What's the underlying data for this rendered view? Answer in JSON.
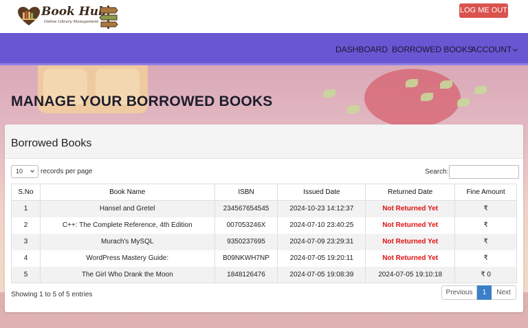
{
  "brand": {
    "name": "Book Hub",
    "tagline": "Online Library Management"
  },
  "header": {
    "logout_label": "LOG ME OUT"
  },
  "nav": {
    "items": [
      {
        "label": "DASHBOARD"
      },
      {
        "label": "BORROWED BOOKS"
      },
      {
        "label": "ACCOUNT"
      }
    ]
  },
  "page": {
    "title": "MANAGE YOUR BORROWED BOOKS"
  },
  "card": {
    "title": "Borrowed Books",
    "length_value": "10",
    "length_suffix": "records per page",
    "search_label": "Search:",
    "search_value": ""
  },
  "table": {
    "columns": [
      "S.No",
      "Book Name",
      "ISBN",
      "Issued Date",
      "Returned Date",
      "Fine Amount"
    ],
    "rows": [
      {
        "sno": "1",
        "name": "Hansel and Gretel",
        "isbn": "234567654545",
        "issued": "2024-10-23 14:12:37",
        "returned": "Not Returned Yet",
        "fine": "₹"
      },
      {
        "sno": "2",
        "name": "C++: The Complete Reference, 4th Edition",
        "isbn": "007053246X",
        "issued": "2024-07-10 23:40:25",
        "returned": "Not Returned Yet",
        "fine": "₹"
      },
      {
        "sno": "3",
        "name": "Murach's MySQL",
        "isbn": "9350237695",
        "issued": "2024-07-09 23:29:31",
        "returned": "Not Returned Yet",
        "fine": "₹"
      },
      {
        "sno": "4",
        "name": "WordPress Mastery Guide:",
        "isbn": "B09NKWH7NP",
        "issued": "2024-07-05 19:20:11",
        "returned": "Not Returned Yet",
        "fine": "₹"
      },
      {
        "sno": "5",
        "name": "The Girl Who Drank the Moon",
        "isbn": "1848126476",
        "issued": "2024-07-05 19:08:39",
        "returned": "2024-07-05 19:10:18",
        "fine": "₹ 0"
      }
    ]
  },
  "footer": {
    "info": "Showing 1 to 5 of 5 entries",
    "previous": "Previous",
    "current_page": "1",
    "next": "Next"
  },
  "colors": {
    "nav": "#6956d2",
    "logout": "#d9534f",
    "not_returned": "#e01010",
    "page_active": "#3a7fc7"
  },
  "icons": [
    "heart-books-logo",
    "signpost-icon",
    "chevron-down-icon"
  ]
}
